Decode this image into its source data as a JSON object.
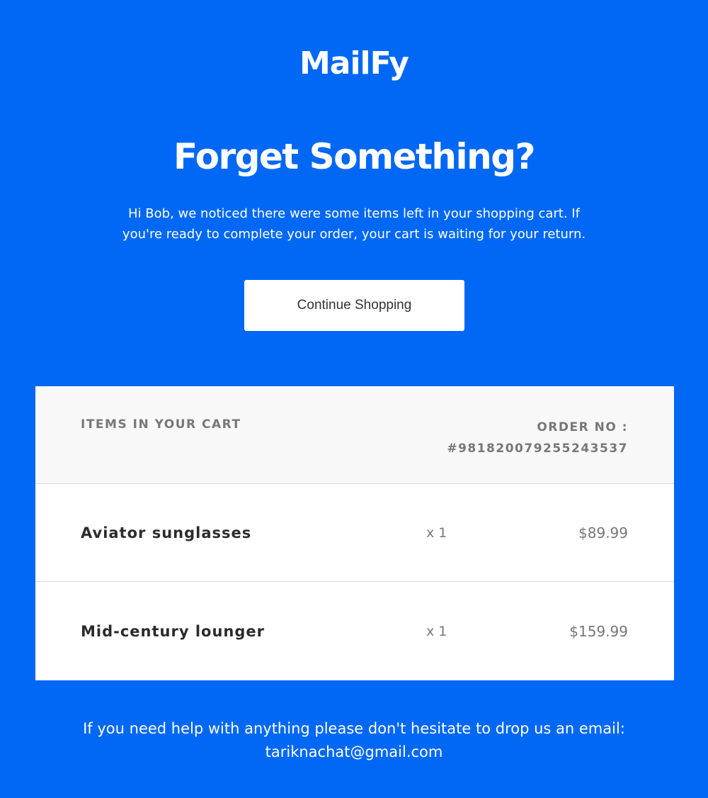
{
  "brand": {
    "logo_text": "MailFy"
  },
  "hero": {
    "title": "Forget Something?",
    "message_line1": "Hi Bob, we noticed there were some items left in your shopping cart. If",
    "message_line2": "you're ready to complete your order, your cart is waiting for your return.",
    "cta_label": "Continue Shopping"
  },
  "cart": {
    "heading": "ITEMS IN YOUR CART",
    "order_label": "ORDER NO :",
    "order_number": "#981820079255243537",
    "items": [
      {
        "name": "Aviator sunglasses",
        "quantity": "x 1",
        "price": "$89.99"
      },
      {
        "name": "Mid-century lounger",
        "quantity": "x 1",
        "price": "$159.99"
      }
    ]
  },
  "footer": {
    "help_text": "If you need help with anything please don't hesitate to drop us an email:",
    "email": "tariknachat@gmail.com"
  },
  "colors": {
    "background": "#0068f5",
    "card": "#ffffff",
    "card_header": "#f8f8f8",
    "muted_text": "#777777",
    "dark_text": "#2b2b2b"
  }
}
